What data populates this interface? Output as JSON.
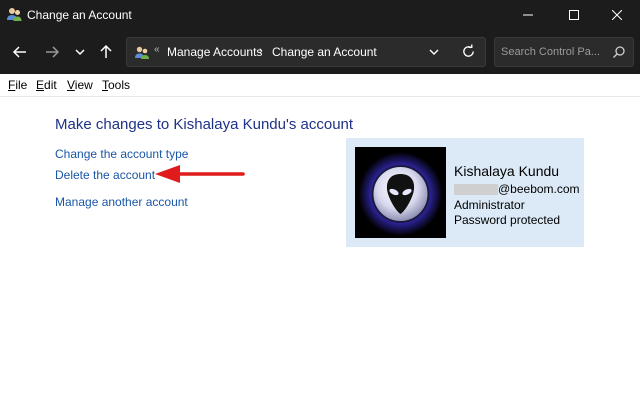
{
  "window": {
    "title": "Change an Account",
    "icon": "user-accounts-icon"
  },
  "address": {
    "chevrons": "«",
    "crumbs": [
      "Manage Accounts",
      "Change an Account"
    ],
    "separator": "›"
  },
  "search": {
    "placeholder": "Search Control Pa..."
  },
  "menu": [
    "File",
    "Edit",
    "View",
    "Tools"
  ],
  "content": {
    "heading": "Make changes to Kishalaya Kundu's account",
    "links": [
      "Change the account type",
      "Delete the account",
      "Manage another account"
    ]
  },
  "account": {
    "name": "Kishalaya Kundu",
    "email": "@beebom.com",
    "role": "Administrator",
    "password_status": "Password protected"
  },
  "colors": {
    "titlebar": "#1c1c1c",
    "link": "#1a56a6",
    "heading": "#1e3287",
    "card": "#dceaf7",
    "annotation_arrow": "#e01b1b"
  }
}
